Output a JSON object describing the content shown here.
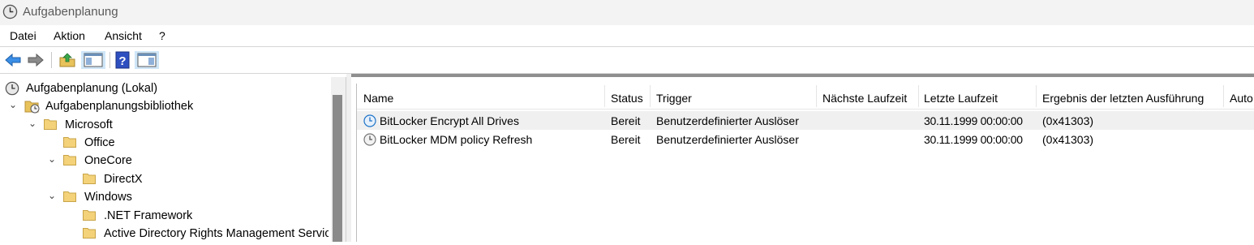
{
  "window": {
    "title": "Aufgabenplanung"
  },
  "menu": {
    "items": [
      "Datei",
      "Aktion",
      "Ansicht",
      "?"
    ]
  },
  "toolbar": {
    "buttons": [
      "back-arrow-icon",
      "forward-arrow-icon",
      "folder-up-icon",
      "show-hide-console-tree-icon",
      "help-icon",
      "show-hide-action-pane-icon"
    ]
  },
  "tree": {
    "root": "Aufgabenplanung (Lokal)",
    "items": [
      {
        "label": "Aufgabenplanungsbibliothek",
        "expanded": true
      },
      {
        "label": "Microsoft",
        "expanded": true
      },
      {
        "label": "Office"
      },
      {
        "label": "OneCore",
        "expanded": true
      },
      {
        "label": "DirectX"
      },
      {
        "label": "Windows",
        "expanded": true
      },
      {
        "label": ".NET Framework"
      },
      {
        "label": "Active Directory Rights Management Servic"
      }
    ]
  },
  "table": {
    "columns": [
      "Name",
      "Status",
      "Trigger",
      "Nächste Laufzeit",
      "Letzte Laufzeit",
      "Ergebnis der letzten Ausführung",
      "Auto"
    ],
    "rows": [
      {
        "name": "BitLocker Encrypt All Drives",
        "status": "Bereit",
        "trigger": "Benutzerdefinierter Auslöser",
        "next_run": "",
        "last_run": "30.11.1999 00:00:00",
        "result": "(0x41303)",
        "selected": true
      },
      {
        "name": "BitLocker MDM policy Refresh",
        "status": "Bereit",
        "trigger": "Benutzerdefinierter Auslöser",
        "next_run": "",
        "last_run": "30.11.1999 00:00:00",
        "result": "(0x41303)",
        "selected": false
      }
    ]
  },
  "colors": {
    "accent": "#1e73c8",
    "folder": "#e8c25a",
    "selection": "#f0f0f0"
  }
}
